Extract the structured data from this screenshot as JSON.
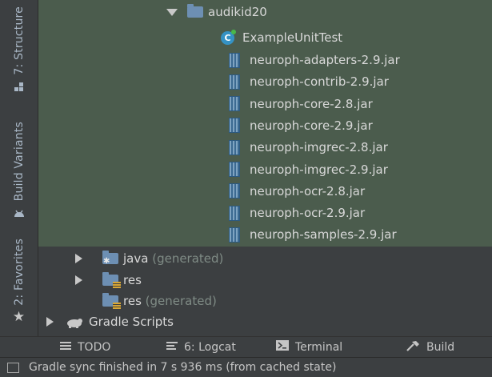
{
  "side_tabs": {
    "structure": "7: Structure",
    "build_variants": "Build Variants",
    "favorites": "2: Favorites"
  },
  "tree": {
    "module": "audikid20",
    "test_class": "ExampleUnitTest",
    "jars": [
      "neuroph-adapters-2.9.jar",
      "neuroph-contrib-2.9.jar",
      "neuroph-core-2.8.jar",
      "neuroph-core-2.9.jar",
      "neuroph-imgrec-2.8.jar",
      "neuroph-imgrec-2.9.jar",
      "neuroph-ocr-2.8.jar",
      "neuroph-ocr-2.9.jar",
      "neuroph-samples-2.9.jar"
    ],
    "java_label": "java",
    "java_suffix": "(generated)",
    "res_label": "res",
    "res_gen_label": "res",
    "res_gen_suffix": "(generated)",
    "gradle": "Gradle Scripts"
  },
  "toolbar": {
    "todo": "TODO",
    "logcat": "6: Logcat",
    "terminal": "Terminal",
    "build": "Build"
  },
  "status": {
    "message": "Gradle sync finished in 7 s 936 ms (from cached state)"
  },
  "colors": {
    "panel": "#3c3f41",
    "selection": "#4b5c4d",
    "text": "#d8d8d8",
    "muted": "#7f8b85"
  }
}
